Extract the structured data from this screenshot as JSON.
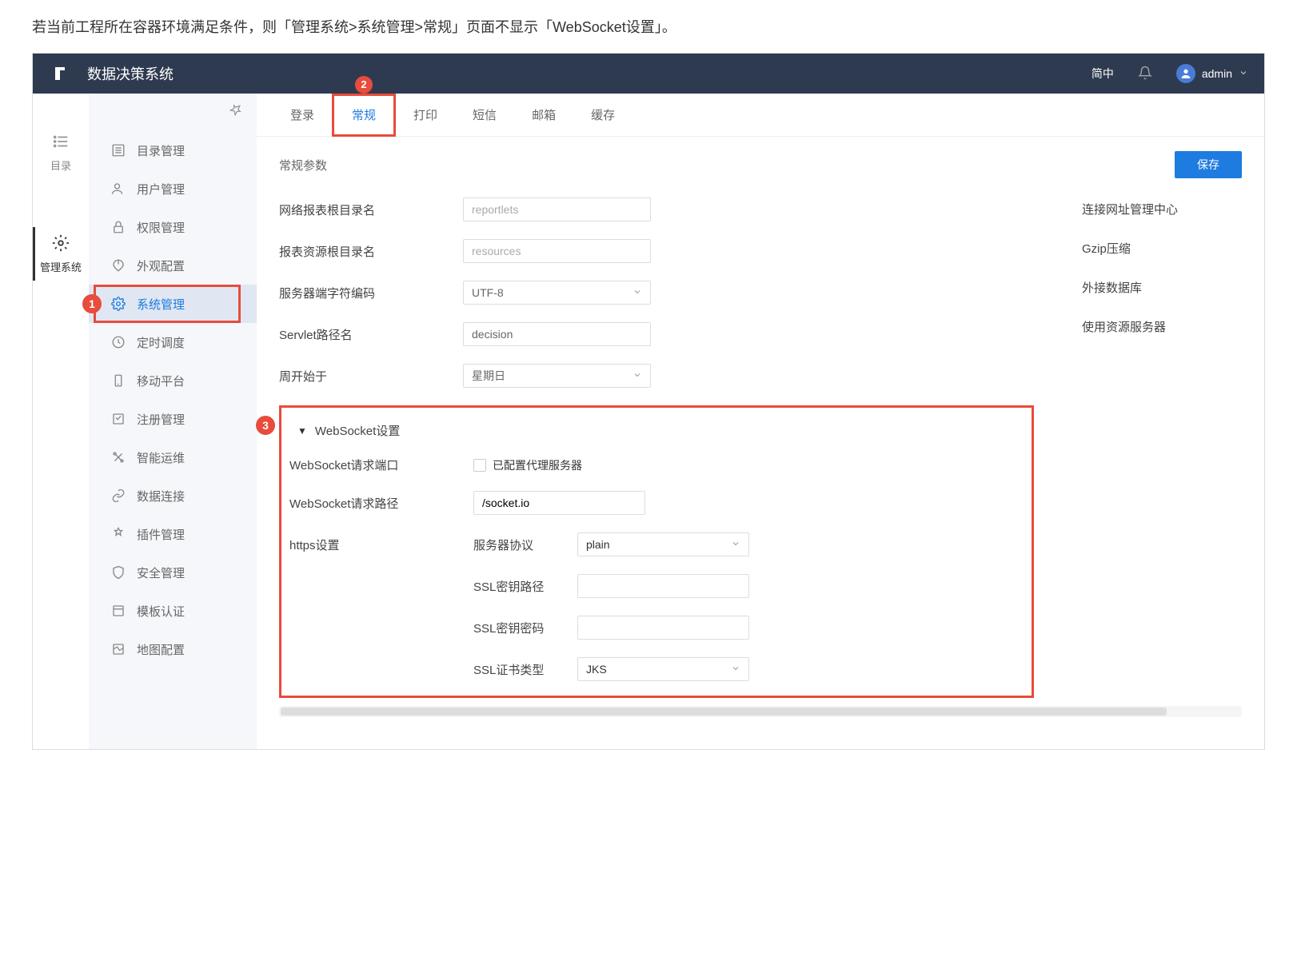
{
  "intro_text": "若当前工程所在容器环境满足条件，则「管理系统>系统管理>常规」页面不显示「WebSocket设置」。",
  "topbar": {
    "title": "数据决策系统",
    "lang": "简中",
    "user": "admin"
  },
  "rail": {
    "item0_label": "目录",
    "item1_label": "管理系统"
  },
  "sidebar": {
    "items": [
      {
        "label": "目录管理"
      },
      {
        "label": "用户管理"
      },
      {
        "label": "权限管理"
      },
      {
        "label": "外观配置"
      },
      {
        "label": "系统管理"
      },
      {
        "label": "定时调度"
      },
      {
        "label": "移动平台"
      },
      {
        "label": "注册管理"
      },
      {
        "label": "智能运维"
      },
      {
        "label": "数据连接"
      },
      {
        "label": "插件管理"
      },
      {
        "label": "安全管理"
      },
      {
        "label": "模板认证"
      },
      {
        "label": "地图配置"
      }
    ]
  },
  "tabs": [
    {
      "label": "登录"
    },
    {
      "label": "常规"
    },
    {
      "label": "打印"
    },
    {
      "label": "短信"
    },
    {
      "label": "邮箱"
    },
    {
      "label": "缓存"
    }
  ],
  "badges": {
    "b1": "1",
    "b2": "2",
    "b3": "3"
  },
  "section": {
    "title": "常规参数",
    "save": "保存"
  },
  "form": {
    "row1_label": "网络报表根目录名",
    "row1_placeholder": "reportlets",
    "row2_label": "报表资源根目录名",
    "row2_placeholder": "resources",
    "row3_label": "服务器端字符编码",
    "row3_value": "UTF-8",
    "row4_label": "Servlet路径名",
    "row4_value": "decision",
    "row5_label": "周开始于",
    "row5_value": "星期日"
  },
  "right_links": {
    "l1": "连接网址管理中心",
    "l2": "Gzip压缩",
    "l3": "外接数据库",
    "l4": "使用资源服务器"
  },
  "ws": {
    "title": "WebSocket设置",
    "port_label": "WebSocket请求端口",
    "proxy_checkbox_label": "已配置代理服务器",
    "path_label": "WebSocket请求路径",
    "path_value": "/socket.io",
    "https_label": "https设置",
    "protocol_label": "服务器协议",
    "protocol_value": "plain",
    "ssl_path_label": "SSL密钥路径",
    "ssl_path_value": "",
    "ssl_pwd_label": "SSL密钥密码",
    "ssl_pwd_value": "",
    "ssl_type_label": "SSL证书类型",
    "ssl_type_value": "JKS"
  }
}
